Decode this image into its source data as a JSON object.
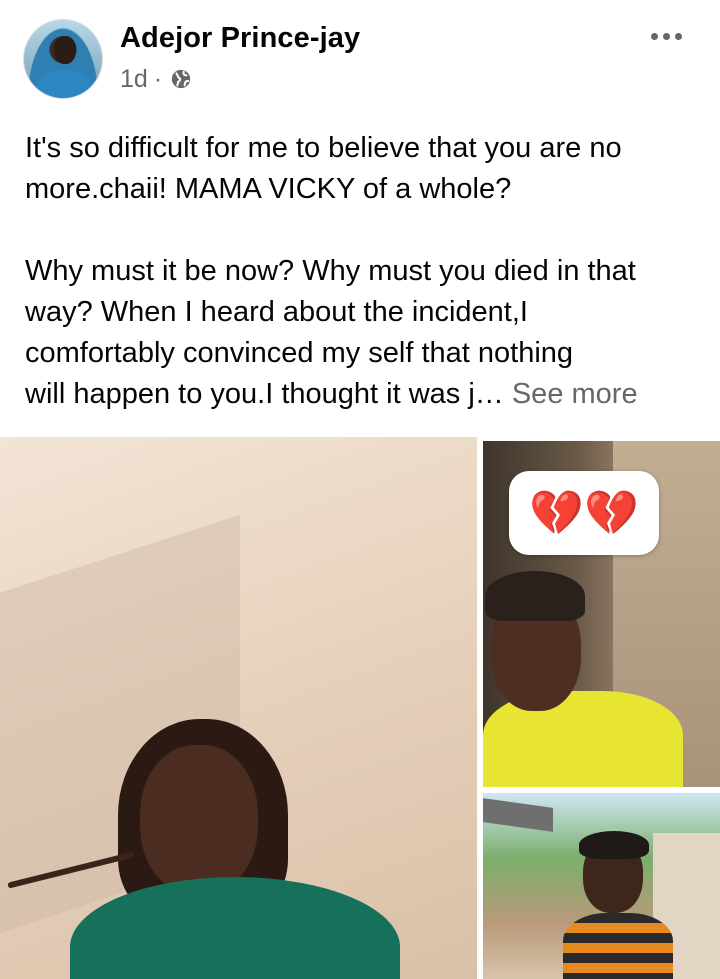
{
  "post": {
    "author_name": "Adejor Prince-jay",
    "timestamp": "1d",
    "separator": "·",
    "privacy_icon": "globe-icon",
    "more_icon": "more-options-icon",
    "text_lines_p1": [
      "It's so difficult for me to believe that you are no",
      "more.chaii! MAMA VICKY of a whole?"
    ],
    "text_lines_p2": [
      "Why must it be now? Why must you died in that",
      "way? When I heard about the incident,I",
      "comfortably convinced my self that nothing",
      "will happen to you.I thought it was j…"
    ],
    "see_more_label": "See more",
    "emoji_overlay": "💔💔"
  },
  "colors": {
    "text": "#050505",
    "secondary_text": "#65676b",
    "background": "#ffffff"
  }
}
